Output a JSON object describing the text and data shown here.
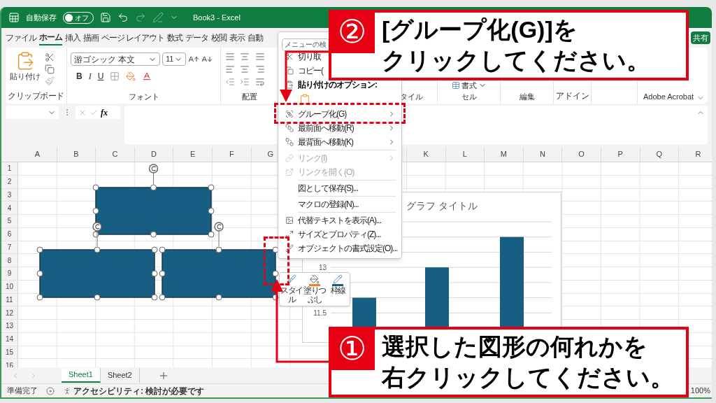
{
  "title_bar": {
    "autosave_label": "自動保存",
    "autosave": {
      "on": false,
      "label": "オフ"
    },
    "title": "Book3 - Excel"
  },
  "ribbon_tabs": [
    {
      "label": "ファイル",
      "selected": false
    },
    {
      "label": "ホーム",
      "selected": true
    },
    {
      "label": "挿入",
      "selected": false
    },
    {
      "label": "描画",
      "selected": false
    },
    {
      "label": "ページ レイアウト",
      "selected": false
    },
    {
      "label": "数式",
      "selected": false
    },
    {
      "label": "データ",
      "selected": false
    },
    {
      "label": "校閲",
      "selected": false
    },
    {
      "label": "表示",
      "selected": false
    },
    {
      "label": "自動",
      "selected": false
    }
  ],
  "share_button": "共有",
  "ribbon": {
    "paste_label": "貼り付け",
    "clipboard_group": "クリップボード",
    "font_name": "游ゴシック 本文",
    "font_size": "11",
    "bold": "B",
    "italic": "I",
    "underline": "U",
    "font_group": "フォント",
    "alignment_group": "配置",
    "style_group": "タイル",
    "format_button": "書式",
    "cells_group": "セル",
    "editing_group": "編集",
    "addins_group": "アドイン",
    "acrobat_group": "Adobe Acrobat"
  },
  "formula_bar": {
    "fx": "fx"
  },
  "sheet": {
    "columns_left": [
      "A",
      "B",
      "C",
      "D",
      "E",
      "F",
      "G"
    ],
    "columns_right": [
      "K",
      "L",
      "M",
      "N",
      "O",
      "P",
      "Q",
      "R"
    ],
    "rows": [
      "1",
      "2",
      "3",
      "4",
      "5",
      "6",
      "7",
      "8",
      "9",
      "10",
      "11",
      "12",
      "13",
      "14",
      "15",
      "16"
    ]
  },
  "shapes": [
    {
      "selected": true
    },
    {
      "selected": true
    },
    {
      "selected": true
    }
  ],
  "chart": {
    "chart_data": {
      "type": "bar",
      "title": "グラフ タイトル",
      "values": [
        12,
        13,
        14
      ],
      "ylim": [
        11,
        14.5
      ],
      "yticks": [
        13,
        11.5
      ]
    }
  },
  "context_menu": {
    "search_placeholder": "メニューの検",
    "items": [
      {
        "kind": "item",
        "label": "切り取",
        "submenu": false,
        "disabled": false
      },
      {
        "kind": "item",
        "label": "コピー(",
        "submenu": false,
        "disabled": false
      },
      {
        "kind": "heading",
        "label": "貼り付けのオプション:"
      },
      {
        "kind": "paste_options"
      },
      {
        "kind": "item",
        "label": "グループ化(G)",
        "submenu": true,
        "disabled": false
      },
      {
        "kind": "item",
        "label": "最前面へ移動(R)",
        "submenu": true,
        "disabled": false
      },
      {
        "kind": "item",
        "label": "最背面へ移動(K)",
        "submenu": true,
        "disabled": false
      },
      {
        "kind": "separator"
      },
      {
        "kind": "item",
        "label": "リンク(I)",
        "submenu": true,
        "disabled": true
      },
      {
        "kind": "item",
        "label": "リンクを開く(O)",
        "submenu": false,
        "disabled": true
      },
      {
        "kind": "separator"
      },
      {
        "kind": "item",
        "label": "図として保存(S)...",
        "submenu": false,
        "disabled": false
      },
      {
        "kind": "separator"
      },
      {
        "kind": "item",
        "label": "マクロの登録(N)...",
        "submenu": false,
        "disabled": false
      },
      {
        "kind": "separator"
      },
      {
        "kind": "item",
        "label": "代替テキストを表示(A)...",
        "submenu": false,
        "disabled": false
      },
      {
        "kind": "item",
        "label": "サイズとプロパティ(Z)...",
        "submenu": false,
        "disabled": false
      },
      {
        "kind": "item",
        "label": "オブジェクトの書式設定(O)...",
        "submenu": false,
        "disabled": false
      }
    ]
  },
  "mini_toolbar": [
    {
      "label": "スタイル"
    },
    {
      "label": "塗りつぶし"
    },
    {
      "label": "枠線"
    }
  ],
  "callouts": [
    {
      "number": "②",
      "lines": [
        "[グループ化(G)]を",
        "クリックしてください。"
      ]
    },
    {
      "number": "①",
      "lines": [
        "選択した図形の何れかを",
        "右クリックしてください。"
      ]
    }
  ],
  "sheet_tabs": [
    {
      "label": "Sheet1",
      "selected": true
    },
    {
      "label": "Sheet2",
      "selected": false
    }
  ],
  "status_bar": {
    "ready": "準備完了",
    "accessibility": "アクセシビリティ: 検討が必要です",
    "zoom": "100%"
  }
}
